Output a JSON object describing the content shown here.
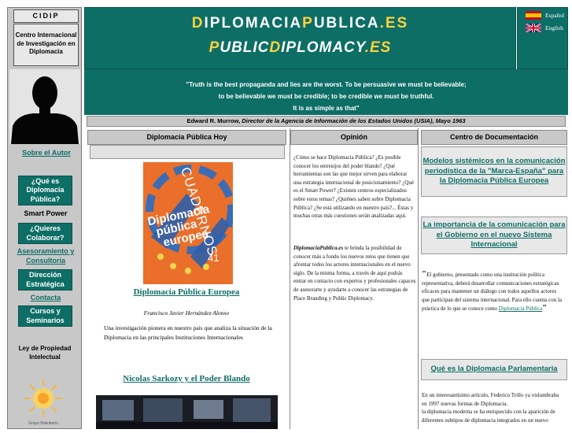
{
  "colors": {
    "teal": "#0d6e66",
    "highlight_yellow": "#ffd23c",
    "panel_grey": "#c8c8c8"
  },
  "sidebar": {
    "acronym": "CIDIP",
    "org_name": "Centro Internacional de Investigación en Diplomacia",
    "about_link": "Sobre el Autor",
    "items": [
      {
        "label": "¿Qué es Diplomacia Pública?",
        "style": "button"
      },
      {
        "label": "Smart Power",
        "style": "text"
      },
      {
        "label": "¿Quieres Colaborar?",
        "style": "button"
      },
      {
        "label": "Asesoramiento y Consultoría",
        "style": "link"
      },
      {
        "label": "Dirección Estratégica",
        "style": "button"
      },
      {
        "label": "Contacta",
        "style": "link"
      },
      {
        "label": "Cursos y Seminarios",
        "style": "button"
      }
    ],
    "law_label": "Ley de Propiedad Intelectual",
    "logo_caption": "Grupo Bdenitario"
  },
  "header": {
    "title_es": {
      "d": "D",
      "iplomacia": "IPLOMACIA",
      "p": "P",
      "ublica": "UBLICA",
      "ext": ".ES"
    },
    "title_en": {
      "p": "P",
      "ublic": "UBLIC",
      "d": "D",
      "iplomacy": "IPLOMACY",
      "ext": ".ES"
    }
  },
  "languages": [
    {
      "label": "Español",
      "icon": "spain-flag-icon"
    },
    {
      "label": "English",
      "icon": "uk-flag-icon"
    }
  ],
  "quote": {
    "line1": "\"Truth is the best propaganda and lies are the worst. To be persuasive we must be believable;",
    "line2": "to be believable we must be credible; to be credible we must be truthful.",
    "line3": "It is as simple as that\"",
    "author": "Edward R. Murrow,",
    "author_title": "Director de la Agencia de Información de los Estados Unidos (USIA), Mayo 1963"
  },
  "col1": {
    "header": "Diplomacia Pública Hoy",
    "book": {
      "series": "CUADERNOS",
      "title_l1": "Diplomacia",
      "title_l2": "pública",
      "title_l3": "europea",
      "number": "41"
    },
    "article1_title": "Diplomacia Pública Europea",
    "article1_author": "Francisco Javier Hernández Alonso",
    "article1_text": "Una investigación pionera en nuestro país que analiza la situación de la Diplomacia en las principales Instituciones Internacionales",
    "article2_title": "Nicolas Sarkozy y el Poder Blando"
  },
  "col2": {
    "header": "Opinión",
    "para1": "¿Cómo se hace Diplomacia Pública? ¿Es posible conocer los entresijos del poder blando? ¿Qué herramientas son las que mejor sirven para elaborar una estrategia internacional de posicionamiento? ¿Qué es el Smart Power? ¿Existen centros especializados sobre estos temas? ¿Quiénes saben sobre Diplomacia Pública? ¿Se está utilizando en nuestro país?... Éstas y muchas otras más cuestiones serán analizadas aquí.",
    "para2_site": "DiplomaciaPublica.es",
    "para2": " te brinda la posibilidad de conocer más a fondo los nuevos retos que tienen que afrontar todos los actores internacionales en el nuevo siglo. De la misma forma, a través de aquí podrás entrar en contacto con expertos y profesionales capaces de asesorarte y ayudarte a conocer las estrategias de Place Branding y Public Diplomacy."
  },
  "col3": {
    "header": "Centro de Documentación",
    "card1": "Modelos sistémicos en la comunicación periodística de la \"Marca-España\" para la Diplomacia Pública Europea",
    "card2": "La importancia de la comunicación para el Gobierno en el nuevo Sistema Internacional",
    "quote_text": "El gobierno, presentado como una institución política representativa, deberá desarrollar comunicaciones estratégicas eficaces para mantener un diálogo con todos aquellos actores que participan del sistema internacional. Para ello cuenta con la práctica de lo que se conoce como ",
    "quote_link": "Diplomacia Pública",
    "card3": "Qué es la Diplomacia Parlamentaria",
    "para3_l1": "En un interesantísimo artículo, Federico Trillo ya vislumbraba en 1997 nuevas formas de Diplomacia.",
    "para3_l2": "la diplomacia moderna se ha enriquecido con la aparición de diferentes subtipos de diplomacia integrados en un nuevo"
  }
}
